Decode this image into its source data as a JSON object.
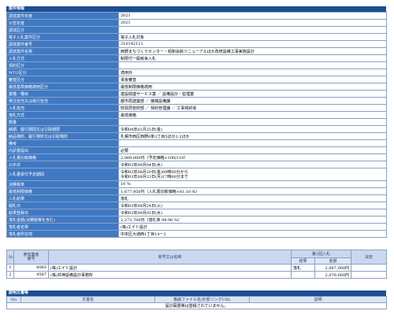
{
  "info_section": {
    "title": "案件情報",
    "rows": [
      {
        "label": "調達案件年度",
        "value": "2021"
      },
      {
        "label": "公告年度",
        "value": "2021"
      },
      {
        "label": "調達区分",
        "value": ""
      },
      {
        "label": "電子入札案件区分",
        "value": "電子入札対象"
      },
      {
        "label": "調達案件番号",
        "value": "210142111"
      },
      {
        "label": "調達案件名称",
        "value": "西野まちづくりセンター・昭和会館リニューアルほか改修設備工事実施設計"
      },
      {
        "label": "入札方式",
        "value": "制限付一般競争入札"
      },
      {
        "label": "契約区分",
        "value": ""
      },
      {
        "label": "WTO区分",
        "value": "適用外"
      },
      {
        "label": "審査区分",
        "value": "事後審査"
      },
      {
        "label": "最低基準価格適用区分",
        "value": "最低制限価格適用"
      },
      {
        "label": "業種／種目",
        "value": "建設関連サービス業 ／ 設備設計・監理業"
      },
      {
        "label": "発注担当又は執行担当",
        "value": "都市局建築部 ／ 機械設備課"
      },
      {
        "label": "入札担当",
        "value": "財政局管財部 ／ 契約管理課 ／ 工事契約係"
      },
      {
        "label": "落札方式",
        "value": "最低価格"
      },
      {
        "label": "数量",
        "value": ""
      },
      {
        "label": "納期、履行期間又は引取期限",
        "value": "令和04年01月25日(金)"
      },
      {
        "label": "納品場所、履行場所又は引取場所",
        "value": "札幌市西区西野6条3丁目5ほか2-2ほか"
      },
      {
        "label": "備考",
        "value": ""
      },
      {
        "label": "内訳書提出",
        "value": "必要"
      },
      {
        "label": "入札書比較価格",
        "value": "2,069,000円（予定価格×100/110）"
      },
      {
        "label": "公示日",
        "value": "令和03年08月04日(水)"
      },
      {
        "label": "入札書受付予定期間",
        "value": "令和03年08月20日(金)09時00分から\n令和03年08月23日(月)17時00分まで"
      },
      {
        "label": "消費税率",
        "value": "10 %"
      },
      {
        "label": "最低制限価格",
        "value": "1,677,950円（入札書比較価格×81.10 %）"
      },
      {
        "label": "入札結果",
        "value": "落札"
      },
      {
        "label": "開札日",
        "value": "令和03年08月24日(火)"
      },
      {
        "label": "結果登録日",
        "value": "令和03年09月01日(水)"
      },
      {
        "label": "落札金額(消費税等を含む)",
        "value": "2,273,700円（落札率 99.90 %）"
      },
      {
        "label": "落札者名称",
        "value": "(株)エイト設計"
      },
      {
        "label": "落札者所在地",
        "value": "中央区大通西1丁目14ー2"
      }
    ]
  },
  "bids": {
    "headers": {
      "no": "No",
      "bidder_no": "参加業者\n番号",
      "name": "商号又は名称",
      "round": "第1回入札",
      "result": "結果",
      "amount": "金額",
      "decision": "決定"
    },
    "rows": [
      {
        "no": "1",
        "bidder_no": "8083",
        "name": "(株)エイト設計",
        "result": "落札",
        "amount": "2,067,000円",
        "decision": ""
      },
      {
        "no": "2",
        "bidder_no": "4587",
        "name": "(株)共神設備設計事務所",
        "result": "",
        "amount": "2,079,000円",
        "decision": ""
      }
    ]
  },
  "docs_section": {
    "title": "説明文書等",
    "headers": {
      "no": "No",
      "doc": "文書名",
      "file": "格納ファイル名/外部リンクURL",
      "note": "説明"
    },
    "empty_message": "設計図書等は登録されていません。"
  }
}
